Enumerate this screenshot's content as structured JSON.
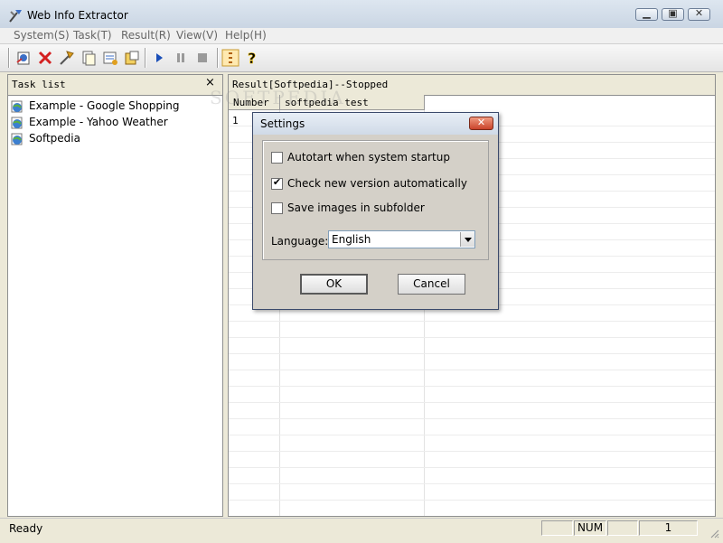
{
  "window": {
    "title": "Web Info Extractor"
  },
  "menu": [
    "System(S)",
    "Task(T)",
    "Result(R)",
    "View(V)",
    "Help(H)"
  ],
  "toolbar": {
    "icons": [
      "new-task-icon",
      "delete-icon",
      "edit-icon",
      "copy-icon",
      "properties-icon",
      "export-icon",
      "play-icon",
      "pause-icon",
      "stop-icon",
      "list-icon",
      "help-icon"
    ]
  },
  "task_panel": {
    "title": "Task list",
    "close": "×",
    "items": [
      "Example - Google Shopping",
      "Example - Yahoo Weather",
      "Softpedia"
    ]
  },
  "result_panel": {
    "title": "Result[Softpedia]--Stopped",
    "columns": [
      "Number",
      "softpedia test"
    ],
    "rows": [
      {
        "number": "1",
        "value": ""
      }
    ]
  },
  "watermark": "SOFTPEDIA",
  "status": {
    "text": "Ready",
    "cells": [
      "",
      "NUM",
      "",
      "1"
    ]
  },
  "dialog": {
    "title": "Settings",
    "close": "✕",
    "options": [
      {
        "label": "Autotart when system startup",
        "checked": false
      },
      {
        "label": "Check new version automatically",
        "checked": true
      },
      {
        "label": "Save images in subfolder",
        "checked": false
      }
    ],
    "language_label": "Language:",
    "language_value": "English",
    "ok": "OK",
    "cancel": "Cancel"
  },
  "colors": {
    "accent": "#3c6fc6",
    "close": "#c9432a"
  }
}
